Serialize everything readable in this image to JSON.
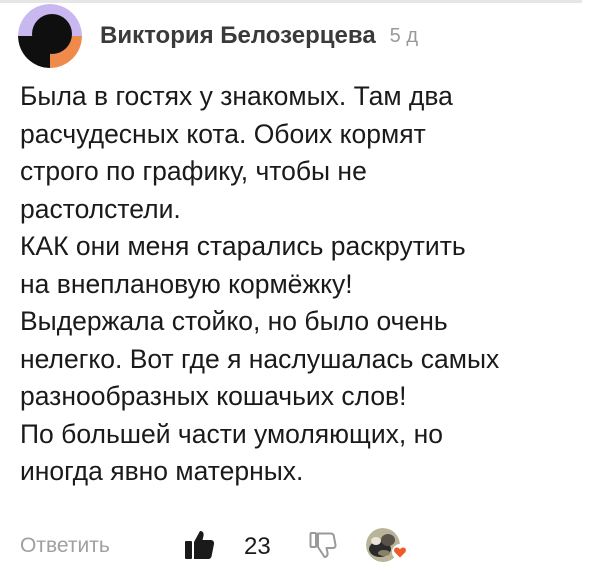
{
  "comment": {
    "author": "Виктория Белозерцева",
    "age": "5 д",
    "lines": [
      "Была в гостях у знакомых. Там два",
      "расчудесных кота. Обоих кормят",
      "строго по графику, чтобы не",
      "растолстели.",
      "КАК они меня старались раскрутить",
      "на внеплановую  кормёжку!",
      "Выдержала стойко, но было очень",
      "нелегко. Вот где я наслушалась самых",
      "разнообразных кошачьих слов!",
      "По большей части умоляющих, но",
      "иногда явно  матерных."
    ]
  },
  "actions": {
    "reply_label": "Ответить",
    "like_count": "23"
  },
  "colors": {
    "avatar_black": "#0f0f0f",
    "avatar_purple": "#c9b7f0",
    "avatar_orange": "#f08a4b",
    "heart": "#f2592a"
  },
  "icons": {
    "like": "thumb-up-icon",
    "dislike": "thumb-down-icon",
    "heart": "heart-icon"
  }
}
